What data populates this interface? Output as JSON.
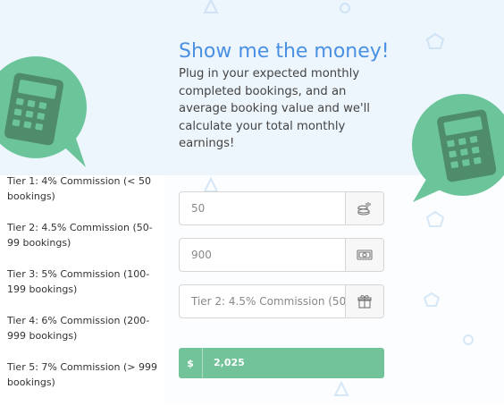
{
  "hero": {
    "title": "Show me the money!",
    "intro": "Plug in your expected monthly completed bookings, and an average booking value and we'll calculate your total monthly earnings!"
  },
  "tiers": [
    "Tier 1: 4% Commission (< 50 bookings)",
    "Tier 2: 4.5% Commission (50-99 bookings)",
    "Tier 3: 5% Commission (100-199 bookings)",
    "Tier 4: 6% Commission (200-999 bookings)",
    "Tier 5: 7% Commission (> 999 bookings)"
  ],
  "calculator": {
    "bookings": {
      "value": "50",
      "icon": "coins-stack-icon"
    },
    "booking_value": {
      "value": "900",
      "icon": "banknote-icon"
    },
    "tier": {
      "value": "Tier 2: 4.5% Commission (50-",
      "icon": "gift-icon"
    },
    "result": {
      "currency": "$",
      "value": "2,025"
    }
  },
  "colors": {
    "accent_green": "#72c29a",
    "bubble_green": "#6cc49b",
    "calculator_dark": "#4f8c6c",
    "title_blue": "#4a90e2",
    "hero_background": "#eef6fd"
  }
}
